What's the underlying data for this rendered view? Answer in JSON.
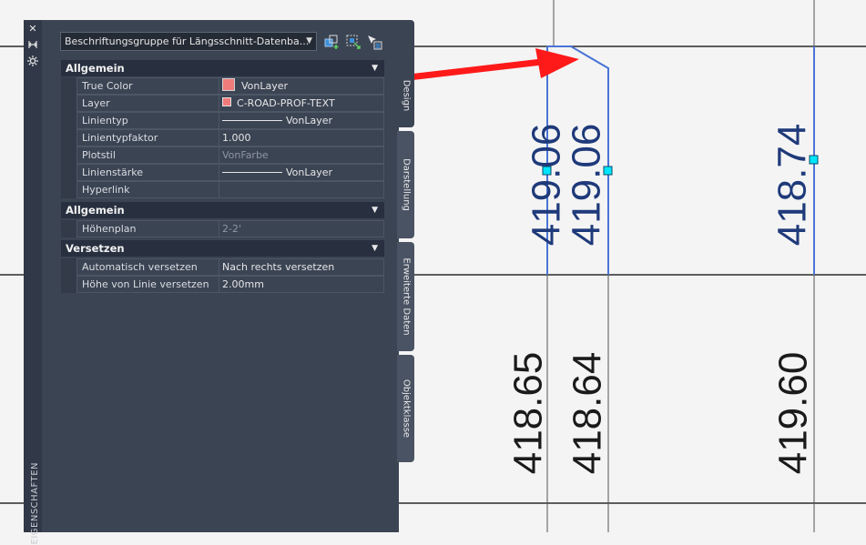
{
  "palette": {
    "title": "EIGENSCHAFTEN",
    "selector": "Beschriftungsgruppe für Längsschnitt-Datenba...",
    "sections": [
      {
        "title": "Allgemein",
        "rows": [
          {
            "label": "True Color",
            "value": "VonLayer"
          },
          {
            "label": "Layer",
            "value": "C-ROAD-PROF-TEXT"
          },
          {
            "label": "Linientyp",
            "value": "VonLayer"
          },
          {
            "label": "Linientypfaktor",
            "value": "1.000"
          },
          {
            "label": "Plotstil",
            "value": "VonFarbe"
          },
          {
            "label": "Linienstärke",
            "value": "VonLayer"
          },
          {
            "label": "Hyperlink",
            "value": ""
          }
        ]
      },
      {
        "title": "Allgemein",
        "rows": [
          {
            "label": "Höhenplan",
            "value": "2-2'"
          }
        ]
      },
      {
        "title": "Versetzen",
        "rows": [
          {
            "label": "Automatisch versetzen",
            "value": "Nach rechts versetzen"
          },
          {
            "label": "Höhe von Linie versetzen",
            "value": "2.00mm"
          }
        ]
      }
    ],
    "tabs": [
      "Design",
      "Darstellung",
      "Erweiterte Daten",
      "Objektklasse"
    ]
  },
  "drawing": {
    "labels_top": [
      "419.06",
      "419.06",
      "418.74"
    ],
    "labels_bottom": [
      "418.65",
      "418.64",
      "419.60"
    ],
    "colors": {
      "label_top": "#1f3a7a",
      "label_bottom": "#1a1a1a",
      "grip": "#00e5ff",
      "arrow": "#ff1a1a"
    }
  }
}
